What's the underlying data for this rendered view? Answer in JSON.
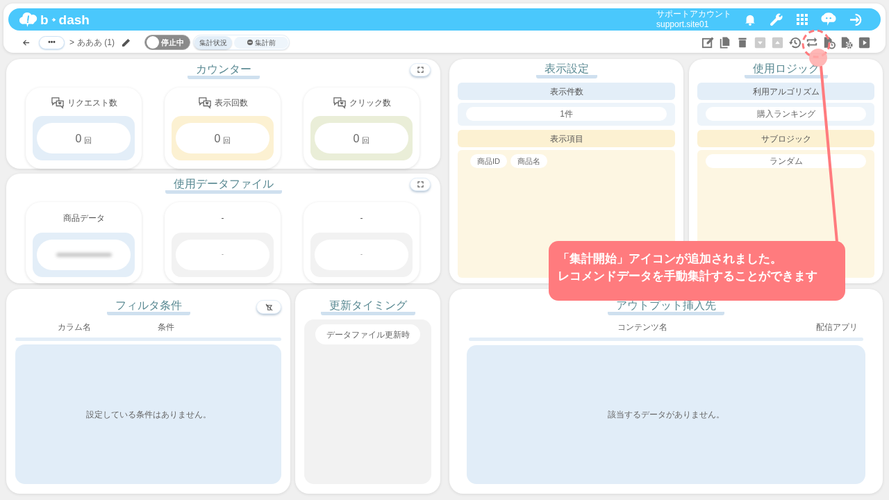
{
  "header": {
    "logo": {
      "left": "b",
      "right": "dash"
    },
    "account": {
      "name": "サポートアカウント",
      "id": "support.site01"
    }
  },
  "toolbar": {
    "more": "•••",
    "separator": ">",
    "name": "あああ (1)",
    "toggle": {
      "label": "停止中",
      "on": false
    },
    "status": {
      "label": "集計状況",
      "value": "集計前"
    },
    "actions": [
      {
        "kind": "edit",
        "disabled": false
      },
      {
        "kind": "copy",
        "disabled": false
      },
      {
        "kind": "trash",
        "disabled": false
      },
      {
        "kind": "download",
        "disabled": true
      },
      {
        "kind": "upload",
        "disabled": true
      },
      {
        "kind": "history",
        "disabled": false
      },
      {
        "kind": "repeat",
        "disabled": false
      },
      {
        "kind": "file-clock",
        "disabled": false
      },
      {
        "kind": "file-gear",
        "disabled": false
      },
      {
        "kind": "play",
        "disabled": false
      }
    ]
  },
  "counter": {
    "title": "カウンター",
    "cards": [
      {
        "label": "リクエスト数",
        "value": "0",
        "unit": "回",
        "color": "#e3eef8"
      },
      {
        "label": "表示回数",
        "value": "0",
        "unit": "回",
        "color": "#fcf1d2"
      },
      {
        "label": "クリック数",
        "value": "0",
        "unit": "回",
        "color": "#eaeed8"
      }
    ]
  },
  "data_files": {
    "title": "使用データファイル",
    "cards": [
      {
        "label": "商品データ",
        "redacted": true,
        "color": "#e3eef8"
      },
      {
        "label": "-",
        "value": "-",
        "redacted": false,
        "color": "#f2f2f2"
      },
      {
        "label": "-",
        "value": "-",
        "redacted": false,
        "color": "#f2f2f2"
      }
    ]
  },
  "display_settings": {
    "title": "表示設定",
    "sections": [
      {
        "header": "表示件数",
        "kind": "pill",
        "values": [
          "1件"
        ]
      },
      {
        "header": "表示項目",
        "kind": "chips",
        "values": [
          "商品ID",
          "商品名"
        ]
      }
    ]
  },
  "logic": {
    "title": "使用ロジック",
    "sections": [
      {
        "header": "利用アルゴリズム",
        "kind": "pill",
        "values": [
          "購入ランキング"
        ]
      },
      {
        "header": "サブロジック",
        "kind": "pill",
        "values": [
          "ランダム"
        ]
      }
    ]
  },
  "filter": {
    "title": "フィルタ条件",
    "columns": [
      "カラム名",
      "条件"
    ],
    "empty": "設定している条件はありません。"
  },
  "timing": {
    "title": "更新タイミング",
    "values": [
      "データファイル更新時"
    ]
  },
  "output": {
    "title": "アウトプット挿入先",
    "columns": [
      "コンテンツ名",
      "配信アプリ"
    ],
    "empty": "該当するデータがありません。"
  },
  "annotation": {
    "lines": [
      "「集計開始」アイコンが追加されました。",
      "レコメンドデータを手動集計することができます"
    ]
  }
}
